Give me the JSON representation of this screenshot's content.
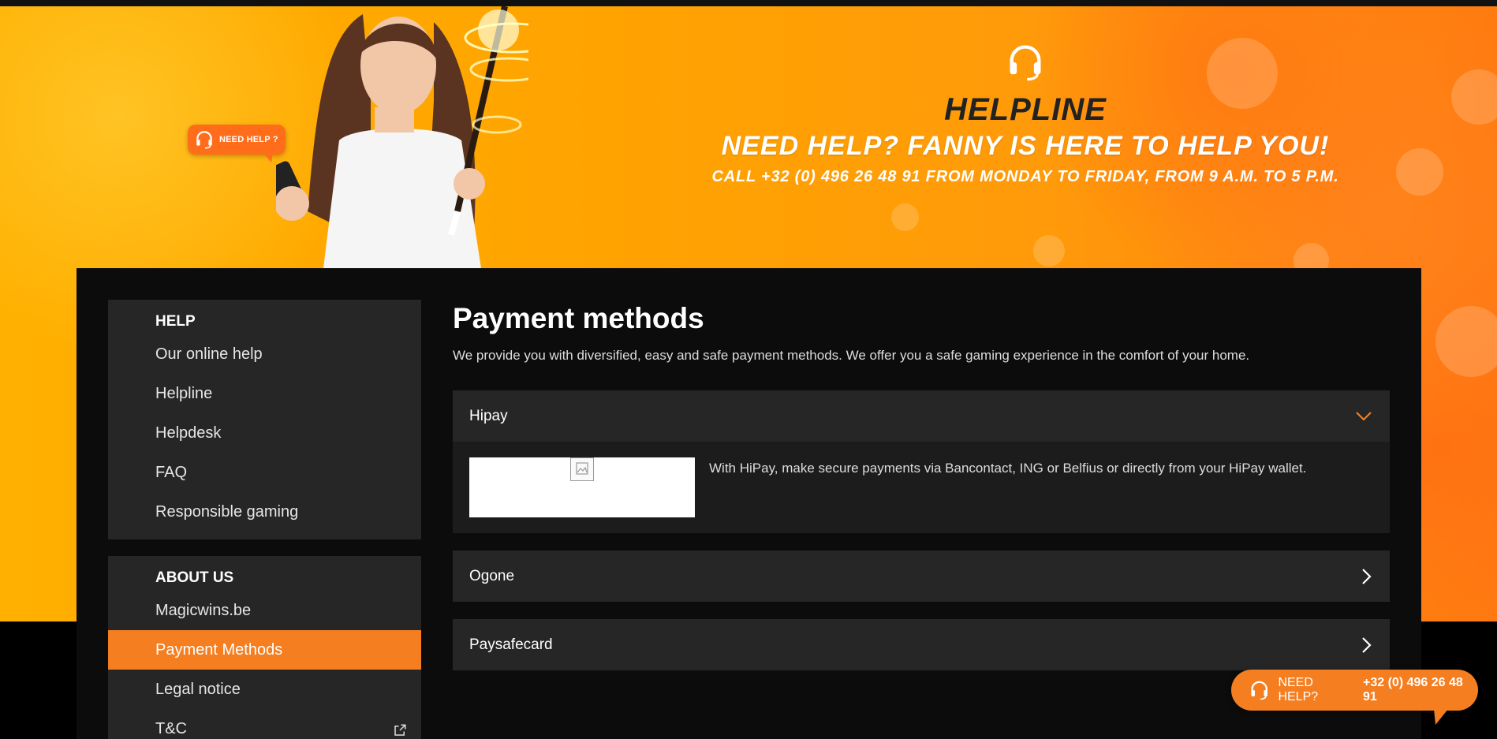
{
  "banner": {
    "badge_text": "NEED HELP ?",
    "title": "HELPLINE",
    "subtitle": "NEED HELP? FANNY IS HERE TO HELP YOU!",
    "call_text": "CALL +32 (0) 496 26 48 91 FROM MONDAY TO FRIDAY, FROM 9 A.M. TO 5 P.M."
  },
  "sidebar": {
    "help_heading": "HELP",
    "help_items": [
      {
        "label": "Our online help"
      },
      {
        "label": "Helpline"
      },
      {
        "label": "Helpdesk"
      },
      {
        "label": "FAQ"
      },
      {
        "label": "Responsible gaming"
      }
    ],
    "about_heading": "ABOUT US",
    "about_items": [
      {
        "label": "Magicwins.be"
      },
      {
        "label": "Payment Methods",
        "active": true
      },
      {
        "label": "Legal notice"
      },
      {
        "label": "T&C",
        "external": true
      }
    ]
  },
  "content": {
    "title": "Payment methods",
    "description": "We provide you with diversified, easy and safe payment methods. We offer you a safe gaming experience in the comfort of your home.",
    "methods": [
      {
        "name": "Hipay",
        "expanded": true,
        "text": "With HiPay, make secure payments via Bancontact, ING or Belfius or directly from your HiPay wallet."
      },
      {
        "name": "Ogone",
        "expanded": false
      },
      {
        "name": "Paysafecard",
        "expanded": false
      }
    ]
  },
  "floating_help": {
    "label": "NEED HELP?",
    "phone": "+32 (0) 496 26 48 91"
  },
  "colors": {
    "accent": "#f47e20",
    "panel": "#0c0c0c",
    "card": "#262626"
  }
}
